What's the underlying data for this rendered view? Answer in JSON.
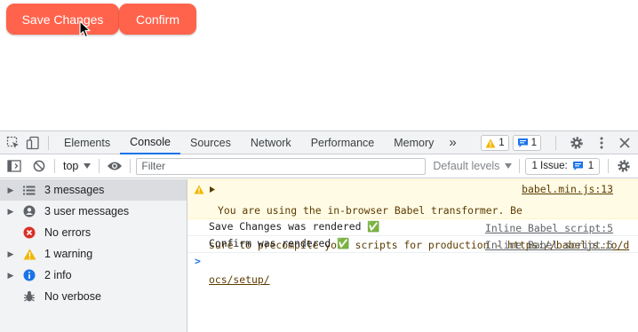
{
  "page": {
    "save_button": "Save Changes",
    "confirm_button": "Confirm"
  },
  "devtools": {
    "tabs": [
      "Elements",
      "Console",
      "Sources",
      "Network",
      "Performance",
      "Memory"
    ],
    "active_tab": "Console",
    "more_tabs": "»",
    "warning_count": "1",
    "message_count": "1",
    "toolbar": {
      "context": "top",
      "filter_placeholder": "Filter",
      "levels": "Default levels",
      "issues_label": "1 Issue:",
      "issues_count": "1"
    },
    "sidebar": [
      {
        "label": "3 messages",
        "icon": "list-icon"
      },
      {
        "label": "3 user messages",
        "icon": "user-icon"
      },
      {
        "label": "No errors",
        "icon": "error-icon"
      },
      {
        "label": "1 warning",
        "icon": "warning-icon"
      },
      {
        "label": "2 info",
        "icon": "info-icon"
      },
      {
        "label": "No verbose",
        "icon": "bug-icon"
      }
    ],
    "console": {
      "warning_line1": "You are using the in-browser Babel transformer. Be",
      "warning_line2": "sure to precompile your scripts for production - ",
      "warning_link_a": "https://babeljs.io/d",
      "warning_link_b": "ocs/setup/",
      "warning_source": "babel.min.js:13",
      "log1": "Save Changes was rendered",
      "log1_source": "Inline Babel script:5",
      "log2": "Confirm was rendered",
      "log2_source": "Inline Babel script:5",
      "check": "✅",
      "prompt": ">"
    },
    "colors": {
      "accent": "#1a73e8",
      "button": "#ff634c",
      "warning_bg": "#fffbe5"
    }
  }
}
